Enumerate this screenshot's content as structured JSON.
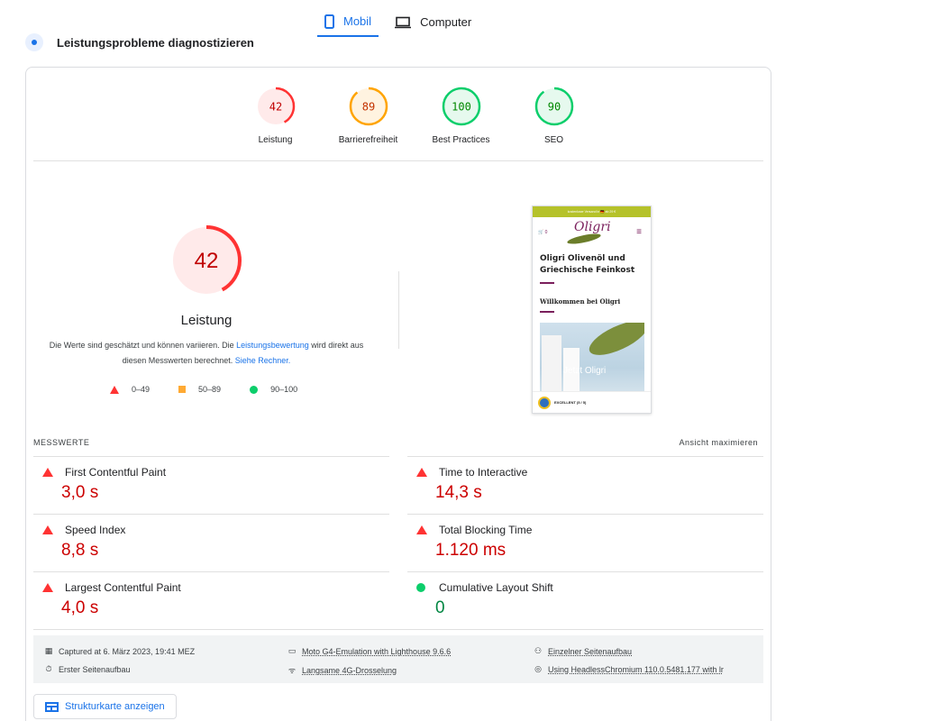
{
  "tabs": [
    {
      "label": "Mobil",
      "icon": "phone-icon",
      "active": true
    },
    {
      "label": "Computer",
      "icon": "laptop-icon",
      "active": false
    }
  ],
  "section_title": "Leistungsprobleme diagnostizieren",
  "scores": [
    {
      "value": "42",
      "label": "Leistung",
      "score": 0.42,
      "color": "#ff3333",
      "fill": "#ffeaea",
      "text_color": "#c00000"
    },
    {
      "value": "89",
      "label": "Barrierefreiheit",
      "score": 0.89,
      "color": "#ffa400",
      "fill": "#fff3e0",
      "text_color": "#c33300"
    },
    {
      "value": "100",
      "label": "Best Practices",
      "score": 1.0,
      "color": "#0cce6b",
      "fill": "#e6f9ee",
      "text_color": "#008800"
    },
    {
      "value": "90",
      "label": "SEO",
      "score": 0.9,
      "color": "#0cce6b",
      "fill": "#e6f9ee",
      "text_color": "#008800"
    }
  ],
  "main_score": {
    "value": "42",
    "label": "Leistung",
    "score": 0.42
  },
  "description": {
    "text1": "Die Werte sind geschätzt und können variieren. Die ",
    "link1": "Leistungsbewertung",
    "text2": " wird direkt aus diesen Messwerten berechnet. ",
    "link2": "Siehe Rechner."
  },
  "legend": [
    {
      "shape": "triangle",
      "range": "0–49"
    },
    {
      "shape": "square",
      "range": "50–89"
    },
    {
      "shape": "circle",
      "range": "90–100"
    }
  ],
  "phone_preview": {
    "banner": "kostenloser Versand in 🇩🇪 ab 29 €",
    "logo": "Oligri",
    "heading": "Oligri Olivenöl und Griechische Feinkost",
    "subheading": "Willkommen bei Oligri",
    "image_text": "Jetzt Oligri",
    "badge_text": "EXCELLENT (5 / 5)"
  },
  "metrics_title": "MESSWERTE",
  "metrics_expand": "Ansicht maximieren",
  "metrics": [
    {
      "label": "First Contentful Paint",
      "value": "3,0 s",
      "status": "fail"
    },
    {
      "label": "Time to Interactive",
      "value": "14,3 s",
      "status": "fail"
    },
    {
      "label": "Speed Index",
      "value": "8,8 s",
      "status": "fail"
    },
    {
      "label": "Total Blocking Time",
      "value": "1.120 ms",
      "status": "fail"
    },
    {
      "label": "Largest Contentful Paint",
      "value": "4,0 s",
      "status": "fail"
    },
    {
      "label": "Cumulative Layout Shift",
      "value": "0",
      "status": "pass"
    }
  ],
  "info": {
    "captured": "Captured at 6. März 2023, 19:41 MEZ",
    "first_load": "Erster Seitenaufbau",
    "device": "Moto G4-Emulation with Lighthouse 9.6.6",
    "throttling": "Langsame 4G-Drosselung",
    "single_load": "Einzelner Seitenaufbau",
    "browser": "Using HeadlessChromium 110.0.5481.177 with lr"
  },
  "treemap_button": "Strukturkarte anzeigen"
}
